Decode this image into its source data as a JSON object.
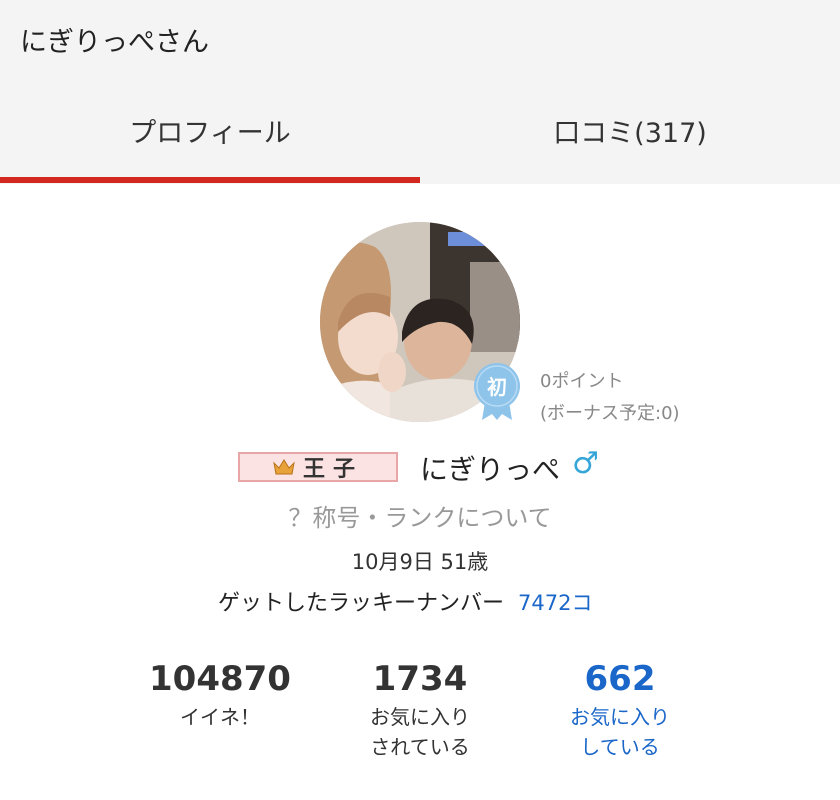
{
  "header": {
    "title": "にぎりっぺさん"
  },
  "tabs": [
    {
      "label": "プロフィール",
      "active": true
    },
    {
      "label": "口コミ(317)",
      "active": false
    }
  ],
  "profile": {
    "badge_label": "初",
    "points": "0ポイント",
    "bonus": "(ボーナス予定:0)",
    "rank": "王子",
    "username": "にぎりっぺ",
    "gender_symbol": "♂",
    "rank_link": "？称号・ランクについて",
    "birthday": "10月9日 51歳",
    "lucky_label": "ゲットしたラッキーナンバー",
    "lucky_count": "7472コ"
  },
  "stats": [
    {
      "value": "104870",
      "label1": "イイネ！",
      "label2": ""
    },
    {
      "value": "1734",
      "label1": "お気に入り",
      "label2": "されている"
    },
    {
      "value": "662",
      "label1": "お気に入り",
      "label2": "している"
    }
  ],
  "colors": {
    "accent_red": "#d2261f",
    "link_blue": "#1b67c9",
    "gender_blue": "#36a6d8",
    "badge_blue": "#8ec3ea"
  }
}
